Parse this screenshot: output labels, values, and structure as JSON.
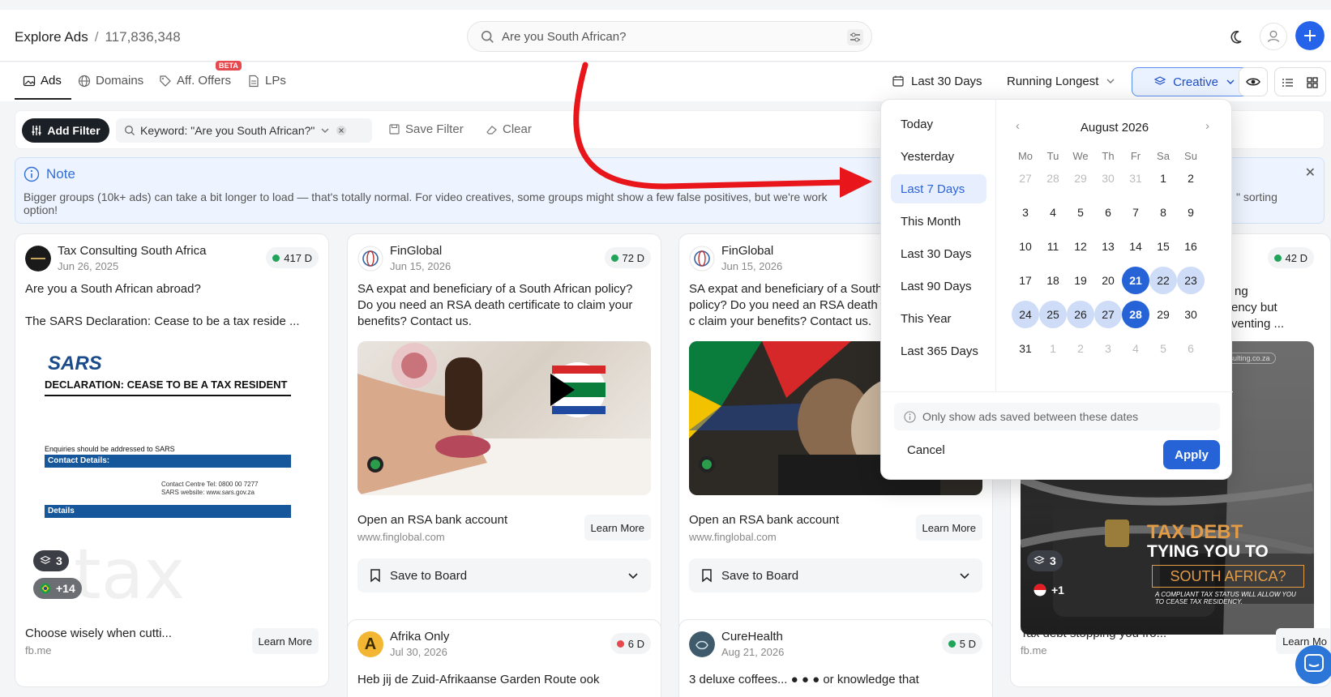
{
  "header": {
    "title": "Explore Ads",
    "separator": "/",
    "count": "117,836,348",
    "search_value": "Are you South African?"
  },
  "tabs": [
    {
      "label": "Ads"
    },
    {
      "label": "Domains"
    },
    {
      "label": "Aff. Offers",
      "badge": "BETA"
    },
    {
      "label": "LPs"
    }
  ],
  "controls": {
    "date_range": "Last 30 Days",
    "sort": "Running Longest",
    "creative": "Creative"
  },
  "filterbar": {
    "add_filter": "Add Filter",
    "keyword_chip": "Keyword: \"Are you South African?\"",
    "save_filter": "Save Filter",
    "clear": "Clear"
  },
  "note": {
    "title": "Note",
    "body_left": "Bigger groups (10k+ ads) can take a bit longer to load — that's totally normal. For video creatives, some groups might show a few false positives, but we're work",
    "body_right": "\" sorting",
    "body_line2": "option!"
  },
  "cards": [
    {
      "brand": "Tax Consulting South Africa",
      "date": "Jun 26, 2025",
      "days": "417 D",
      "copy1": "Are you a South African abroad?",
      "copy2": "The SARS Declaration: Cease to be a tax reside ...",
      "headline": "Choose wisely when cutti...",
      "url": "fb.me",
      "learn": "Learn More",
      "stack": "3",
      "countries": "+14",
      "img_logo": "SARS",
      "img_title": "DECLARATION: CEASE TO BE A TAX RESIDENT",
      "img_enq": "Enquiries should be addressed to SARS",
      "img_contact": "Contact Details:",
      "img_tel": "Contact Centre Tel: 0800 00 7277",
      "img_web": "SARS website: www.sars.gov.za",
      "img_details": "Details",
      "img_tax": "tax"
    },
    {
      "brand": "FinGlobal",
      "date": "Jun 15, 2026",
      "days": "72 D",
      "copy1": "SA expat and beneficiary of a South African policy? Do you need an RSA death certificate to claim your benefits? Contact us.",
      "headline": "Open an RSA bank account",
      "url": "www.finglobal.com",
      "learn": "Learn More",
      "save": "Save to Board"
    },
    {
      "brand": "FinGlobal",
      "date": "Jun 15, 2026",
      "days": "",
      "copy1": "SA expat and beneficiary of a South policy? Do you need an RSA death c claim your benefits? Contact us.",
      "headline": "Open an RSA bank account",
      "url": "www.finglobal.com",
      "learn": "Learn More",
      "save": "Save to Board"
    },
    {
      "days": "42 D",
      "copy_frag1": "ng",
      "copy_frag2": "ency but",
      "copy_frag3": "venting ...",
      "headline": "Tax debt stopping you fro...",
      "url": "fb.me",
      "learn": "Learn Mo",
      "stack": "3",
      "countries": "+1",
      "img_l1": "TAX DEBT",
      "img_l2": "TYING YOU TO",
      "img_l3": "SOUTH AFRICA?",
      "img_small": "A COMPLIANT TAX STATUS WILL ALLOW YOU TO CEASE TAX RESIDENCY.",
      "img_url": "consulting.co.za"
    }
  ],
  "cards_row2": [
    {
      "brand": "Afrika Only",
      "date": "Jul 30, 2026",
      "days": "6 D",
      "copy": "Heb jij de Zuid-Afrikaanse Garden Route ook",
      "avatar_letter": "A"
    },
    {
      "brand": "CureHealth",
      "date": "Aug 21, 2026",
      "days": "5 D",
      "copy": "3 deluxe coffees... ● ● ● or knowledge that"
    }
  ],
  "datepicker": {
    "presets": [
      "Today",
      "Yesterday",
      "Last 7 Days",
      "This Month",
      "Last 30 Days",
      "Last 90 Days",
      "This Year",
      "Last 365 Days"
    ],
    "selected_preset": "Last 7 Days",
    "month": "August 2026",
    "weekdays": [
      "Mo",
      "Tu",
      "We",
      "Th",
      "Fr",
      "Sa",
      "Su"
    ],
    "weeks": [
      [
        "27",
        "28",
        "29",
        "30",
        "31",
        "1",
        "2"
      ],
      [
        "3",
        "4",
        "5",
        "6",
        "7",
        "8",
        "9"
      ],
      [
        "10",
        "11",
        "12",
        "13",
        "14",
        "15",
        "16"
      ],
      [
        "17",
        "18",
        "19",
        "20",
        "21",
        "22",
        "23"
      ],
      [
        "24",
        "25",
        "26",
        "27",
        "28",
        "29",
        "30"
      ],
      [
        "31",
        "1",
        "2",
        "3",
        "4",
        "5",
        "6"
      ]
    ],
    "range_start": "21",
    "range_end": "28",
    "only_show": "Only show ads saved between these dates",
    "cancel": "Cancel",
    "apply": "Apply"
  },
  "colors": {
    "accent": "#2563d6",
    "annotation_arrow": "#e8161b",
    "active_green": "#22a35a"
  }
}
